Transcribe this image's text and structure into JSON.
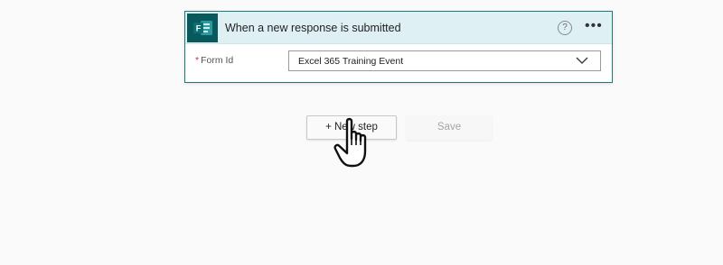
{
  "trigger": {
    "title": "When a new response is submitted",
    "help_glyph": "?",
    "more_glyph": "•••",
    "field": {
      "required_mark": "*",
      "label": "Form Id",
      "value": "Excel 365 Training Event"
    },
    "icon": "microsoft-forms-icon"
  },
  "actions": {
    "new_step_label": "+ New step",
    "save_label": "Save"
  },
  "cursor": "hand-pointer-icon",
  "colors": {
    "accent": "#1f7a72",
    "header_bg": "#dff0f4",
    "forms_brand": "#09585c",
    "required": "#c4314b"
  }
}
